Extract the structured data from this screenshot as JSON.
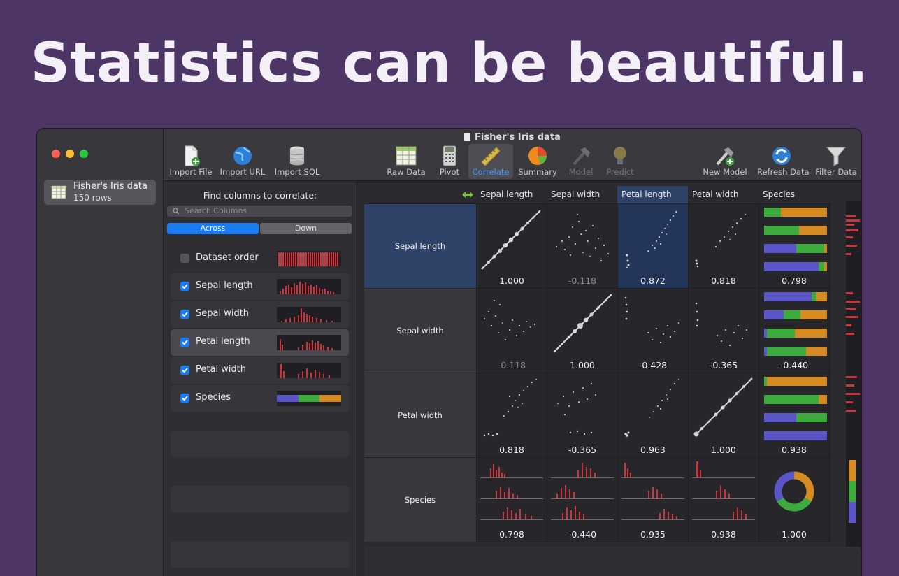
{
  "headline": "Statistics can be beautiful.",
  "window": {
    "title": "Fisher's Iris data"
  },
  "sidebar": {
    "items": [
      {
        "title": "Fisher's Iris data",
        "subtitle": "150 rows"
      }
    ]
  },
  "toolbar": {
    "import_file": "Import File",
    "import_url": "Import URL",
    "import_sql": "Import SQL",
    "raw_data": "Raw Data",
    "pivot": "Pivot",
    "correlate": "Correlate",
    "summary": "Summary",
    "model": "Model",
    "predict": "Predict",
    "new_model": "New Model",
    "refresh_data": "Refresh Data",
    "filter_data": "Filter Data",
    "active": "Correlate"
  },
  "panel": {
    "title": "Find columns to correlate:",
    "search_placeholder": "Search Columns",
    "seg_across": "Across",
    "seg_down": "Down",
    "columns": [
      {
        "label": "Dataset order",
        "checked": false
      },
      {
        "label": "Sepal length",
        "checked": true
      },
      {
        "label": "Sepal width",
        "checked": true
      },
      {
        "label": "Petal length",
        "checked": true,
        "selected": true
      },
      {
        "label": "Petal width",
        "checked": true
      },
      {
        "label": "Species",
        "checked": true
      }
    ]
  },
  "grid": {
    "columns": [
      "Sepal length",
      "Sepal width",
      "Petal length",
      "Petal width",
      "Species"
    ],
    "rows": [
      {
        "label": "Sepal length",
        "values": [
          "1.000",
          "-0.118",
          "0.872",
          "0.818",
          "0.798"
        ]
      },
      {
        "label": "Sepal width",
        "values": [
          "-0.118",
          "1.000",
          "-0.428",
          "-0.365",
          "-0.440"
        ]
      },
      {
        "label": "Petal width",
        "values": [
          "0.818",
          "-0.365",
          "0.963",
          "1.000",
          "0.938"
        ]
      },
      {
        "label": "Species",
        "values": [
          "0.798",
          "-0.440",
          "0.935",
          "0.938",
          "1.000"
        ]
      }
    ],
    "selected_column": "Petal length",
    "selected_row": "Sepal length"
  },
  "colors": {
    "blue": "#5a56c8",
    "green": "#3eab3e",
    "orange": "#d58a22",
    "bar_red": "#c8353d",
    "accent": "#1a7cf5"
  }
}
